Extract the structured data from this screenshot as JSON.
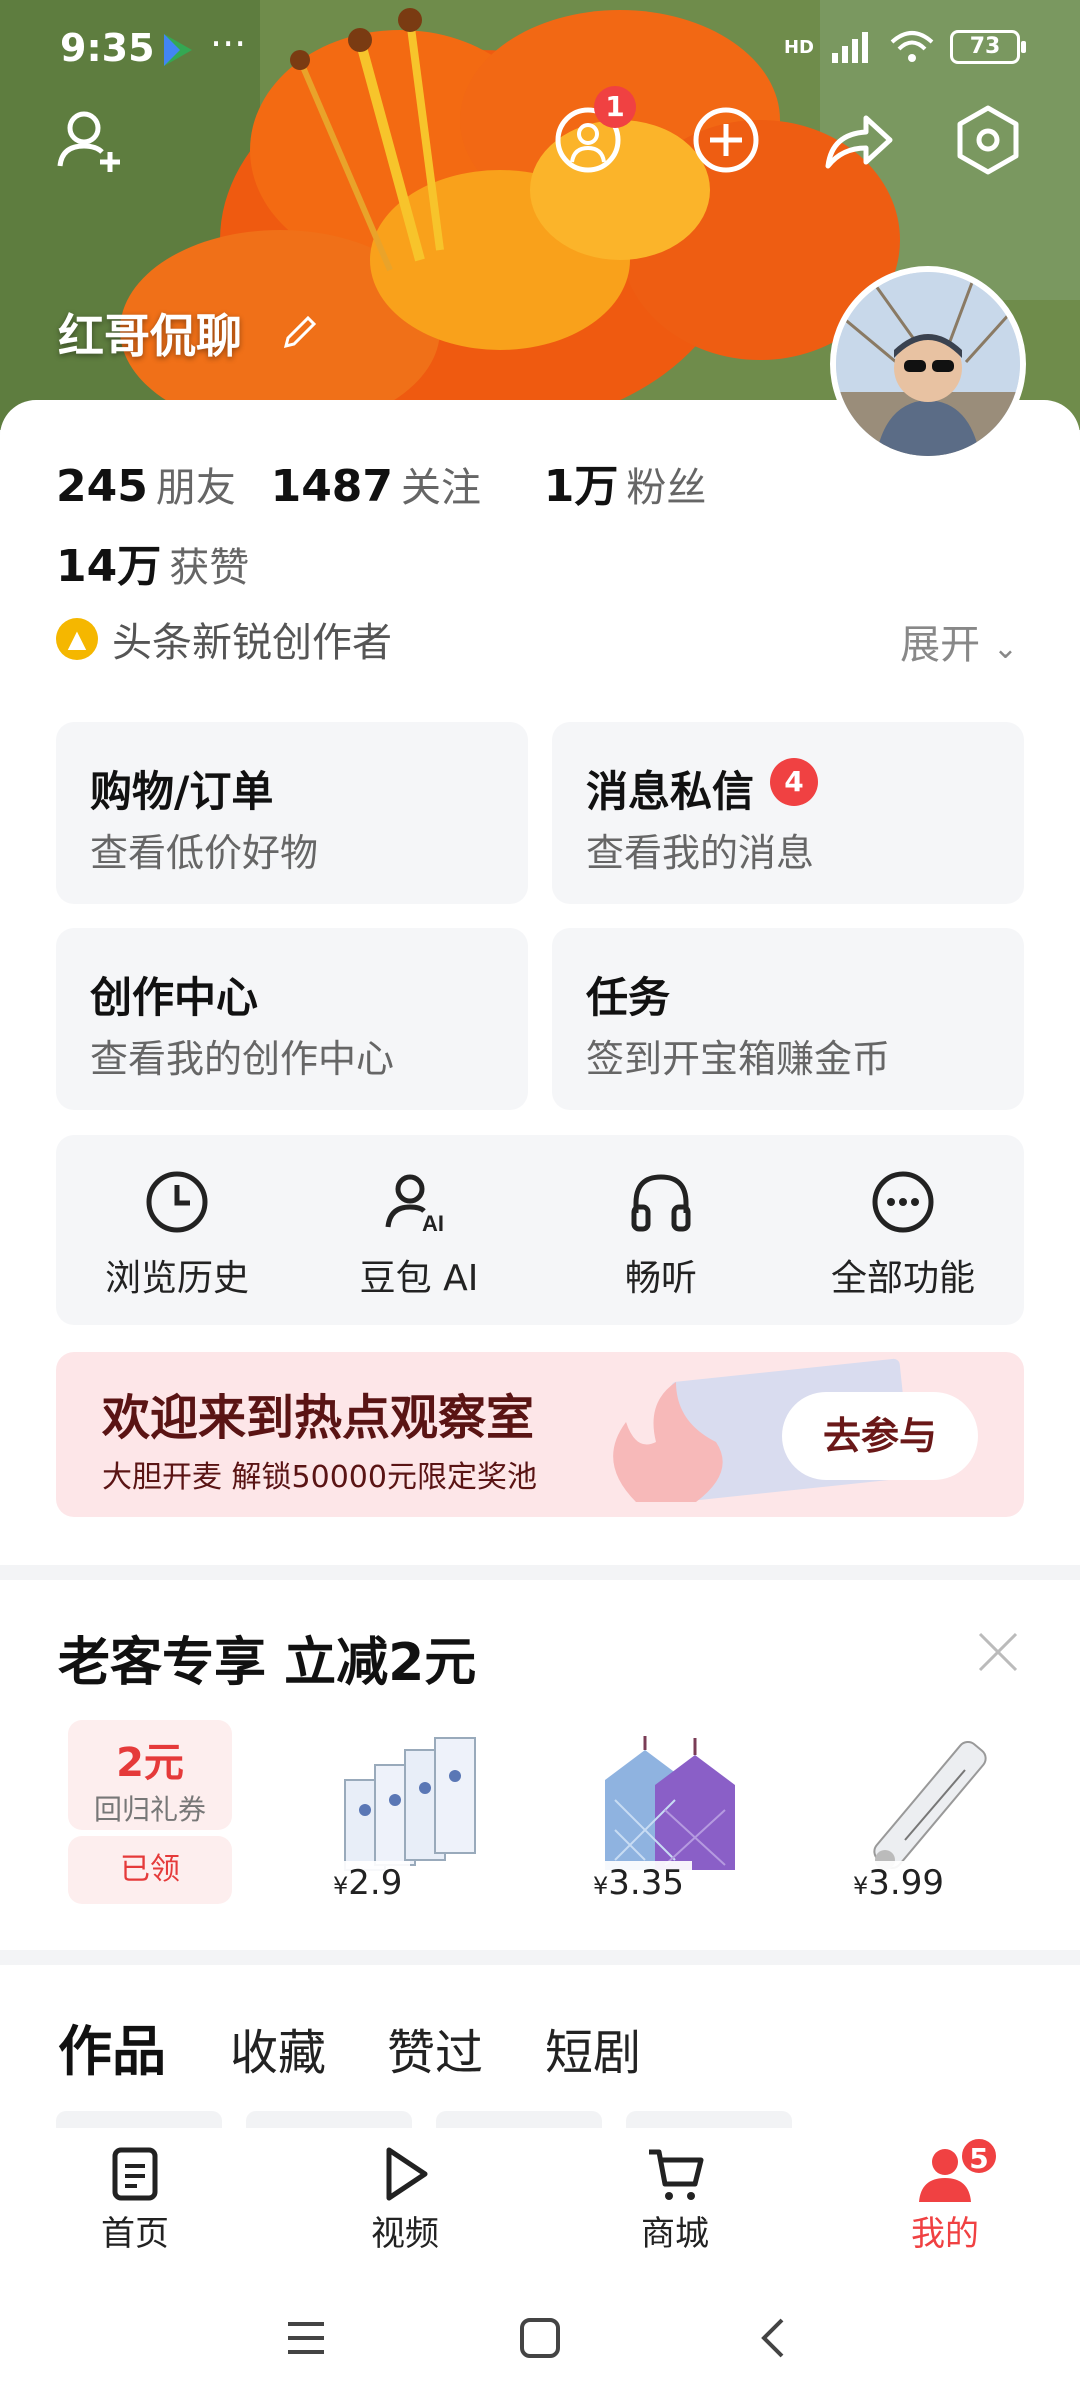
{
  "status_bar": {
    "time": "9:35",
    "more": "···",
    "network": "HD",
    "battery": "73"
  },
  "header": {
    "nickname": "红哥侃聊",
    "notification_count": "1"
  },
  "stats": {
    "friends_count": "245",
    "friends_label": "朋友",
    "following_count": "1487",
    "following_label": "关注",
    "fans_count": "1万",
    "fans_label": "粉丝",
    "likes_count": "14万",
    "likes_label": "获赞"
  },
  "creator": {
    "badge_text": "头条新锐创作者",
    "expand_label": "展开"
  },
  "tiles": {
    "shopping": {
      "title": "购物/订单",
      "subtitle": "查看低价好物"
    },
    "messages": {
      "title": "消息私信",
      "subtitle": "查看我的消息",
      "badge": "4"
    },
    "creation": {
      "title": "创作中心",
      "subtitle": "查看我的创作中心"
    },
    "tasks": {
      "title": "任务",
      "subtitle": "签到开宝箱赚金币"
    }
  },
  "quick_actions": [
    {
      "label": "浏览历史",
      "icon": "clock-icon"
    },
    {
      "label": "豆包 AI",
      "icon": "ai-person-icon"
    },
    {
      "label": "畅听",
      "icon": "headphones-icon"
    },
    {
      "label": "全部功能",
      "icon": "more-dots-icon"
    }
  ],
  "banner": {
    "title": "欢迎来到热点观察室",
    "subtitle": "大胆开麦 解锁50000元限定奖池",
    "button": "去参与"
  },
  "promo": {
    "title": "老客专享 立减2元",
    "coupon": {
      "value": "2元",
      "name": "回归礼券",
      "status": "已领"
    },
    "products": [
      {
        "currency": "¥",
        "price": "2.9",
        "icon": "paper-tissue-icon"
      },
      {
        "currency": "¥",
        "price": "3.35",
        "icon": "towel-icon"
      },
      {
        "currency": "¥",
        "price": "3.99",
        "icon": "thermometer-icon"
      }
    ]
  },
  "tabs": [
    "作品",
    "收藏",
    "赞过",
    "短剧"
  ],
  "bottom_nav": {
    "items": [
      {
        "label": "首页",
        "icon": "home-doc-icon"
      },
      {
        "label": "视频",
        "icon": "play-icon"
      },
      {
        "label": "商城",
        "icon": "cart-icon"
      },
      {
        "label": "我的",
        "icon": "user-icon",
        "badge": "5"
      }
    ]
  },
  "colors": {
    "accent_red": "#f04142",
    "tile_bg": "#f5f6f8",
    "banner_bg": "#fde6e8"
  }
}
